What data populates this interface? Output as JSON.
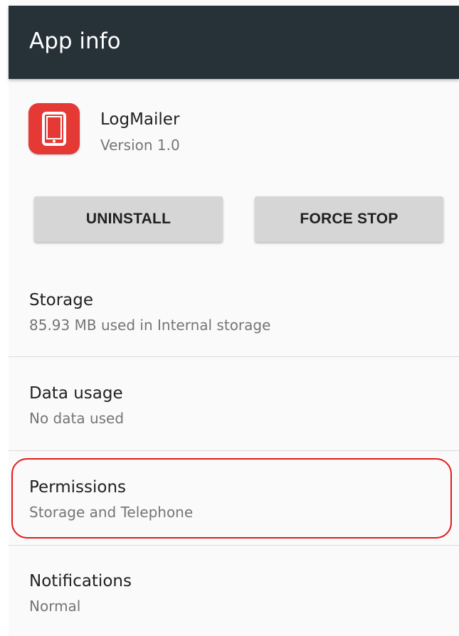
{
  "app_bar": {
    "title": "App info"
  },
  "app": {
    "name": "LogMailer",
    "version": "Version 1.0",
    "icon": "logmailer-tablet-icon",
    "icon_color": "#e53935"
  },
  "buttons": {
    "uninstall": "UNINSTALL",
    "force_stop": "FORCE STOP"
  },
  "settings": [
    {
      "title": "Storage",
      "subtitle": "85.93 MB used in Internal storage"
    },
    {
      "title": "Data usage",
      "subtitle": "No data used"
    },
    {
      "title": "Permissions",
      "subtitle": "Storage and Telephone",
      "highlighted": true
    },
    {
      "title": "Notifications",
      "subtitle": "Normal"
    }
  ],
  "colors": {
    "app_bar": "#263238",
    "highlight_outline": "#e41a1a",
    "button_bg": "#d6d6d6"
  }
}
